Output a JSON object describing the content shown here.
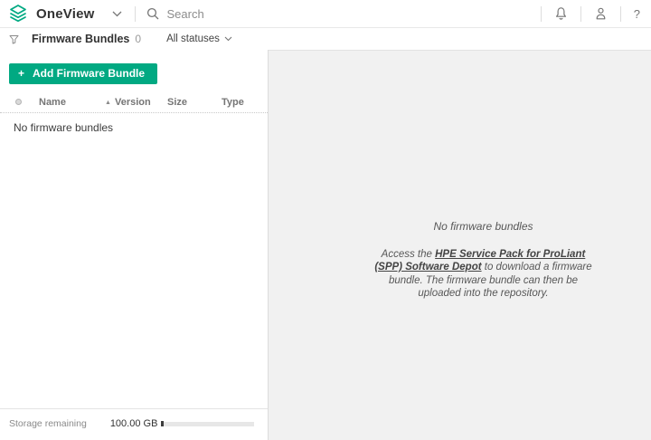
{
  "header": {
    "app_name": "OneView",
    "search_placeholder": "Search"
  },
  "icons": {
    "plus": "+",
    "sort_ascending": "▲",
    "help": "?"
  },
  "toolbar": {
    "title": "Firmware Bundles",
    "count": "0",
    "status_filter_label": "All statuses"
  },
  "left_panel": {
    "add_button_label": "Add Firmware Bundle",
    "columns": {
      "name": "Name",
      "version": "Version",
      "size": "Size",
      "type": "Type"
    },
    "empty_text": "No firmware bundles",
    "storage_label": "Storage remaining",
    "storage_value": "100.00 GB"
  },
  "main_panel": {
    "empty_title": "No firmware bundles",
    "message_before_link": "Access the ",
    "link_text": "HPE Service Pack for ProLiant (SPP) Software Depot",
    "message_after_link": " to download a firmware bundle. The firmware bundle can then be uploaded into the repository."
  },
  "colors": {
    "brand_green": "#01a982",
    "main_panel_bg": "#f1f1f1"
  }
}
